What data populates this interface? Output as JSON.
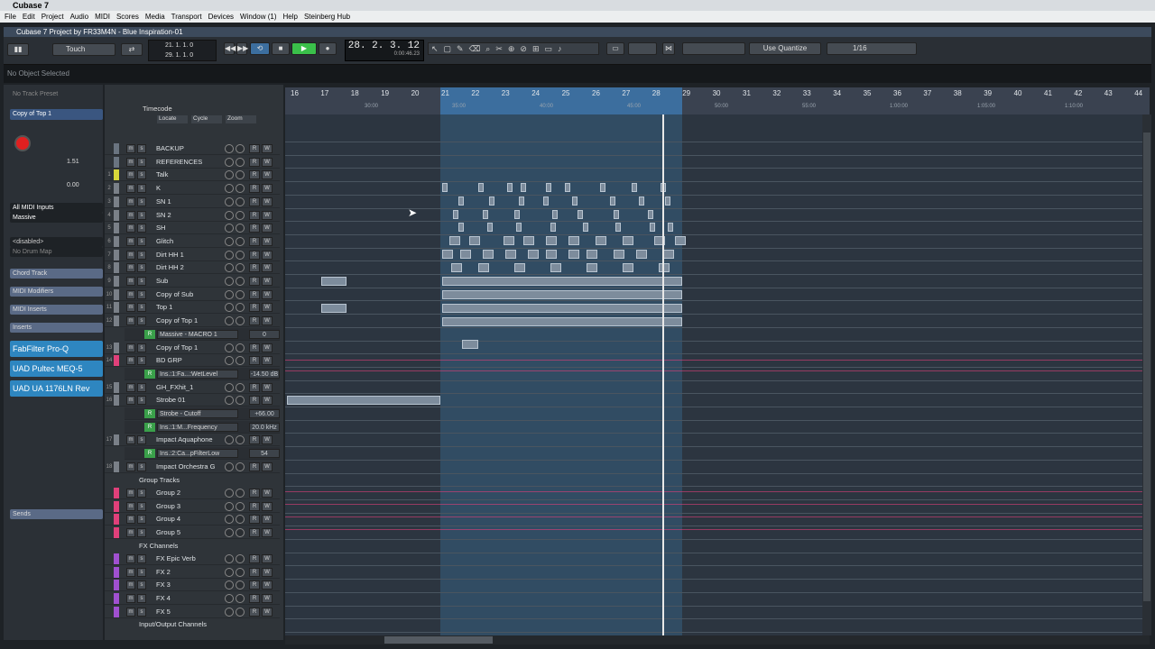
{
  "os": {
    "title": "Cubase 7",
    "menu": [
      "File",
      "Edit",
      "Project",
      "Audio",
      "MIDI",
      "Scores",
      "Media",
      "Transport",
      "Devices",
      "Window (1)",
      "Help",
      "Steinberg Hub"
    ]
  },
  "project": {
    "title": "Cubase 7 Project by FR33M4N - Blue Inspiration-01"
  },
  "toolbar": {
    "mode": "Touch",
    "left_locator": "21. 1. 1. 0",
    "right_locator": "29. 1. 1. 0",
    "position": "28. 2. 3. 12",
    "position_sub": "0:00:46.23",
    "quantize_label": "Use Quantize",
    "quantize_value": "1/16"
  },
  "infoline": {
    "text": "No Object Selected"
  },
  "inspector": {
    "preset": "No Track Preset",
    "track_name": "Copy of Top 1",
    "volume": "1.51",
    "pan": "0.00",
    "input": "All MIDI Inputs",
    "output": "Massive",
    "disabled": "<disabled>",
    "drum_map": "No Drum Map",
    "sections": [
      "Chord Track",
      "MIDI Modifiers",
      "MIDI Inserts",
      "Inserts"
    ],
    "plugins": [
      "FabFilter Pro-Q",
      "UAD Pultec MEQ-5",
      "UAD UA 1176LN Rev"
    ],
    "sends": "Sends"
  },
  "tracklist": {
    "timecode_label": "Timecode",
    "locate": "Locate",
    "cycle": "Cycle",
    "zoom": "Zoom",
    "tracks": [
      {
        "num": "",
        "name": "BACKUP",
        "color": "#6a7480"
      },
      {
        "num": "",
        "name": "REFERENCES",
        "color": "#6a7480"
      },
      {
        "num": "1",
        "name": "Talk",
        "color": "#d8d83a"
      },
      {
        "num": "2",
        "name": "K",
        "color": "#7a8088"
      },
      {
        "num": "3",
        "name": "SN 1",
        "color": "#7a8088"
      },
      {
        "num": "4",
        "name": "SN 2",
        "color": "#7a8088"
      },
      {
        "num": "5",
        "name": "SH",
        "color": "#7a8088"
      },
      {
        "num": "6",
        "name": "Glitch",
        "color": "#7a8088"
      },
      {
        "num": "7",
        "name": "Dirt HH 1",
        "color": "#7a8088"
      },
      {
        "num": "8",
        "name": "Dirt HH 2",
        "color": "#7a8088"
      },
      {
        "num": "9",
        "name": "Sub",
        "color": "#7a8088"
      },
      {
        "num": "10",
        "name": "Copy of Sub",
        "color": "#7a8088"
      },
      {
        "num": "11",
        "name": "Top 1",
        "color": "#7a8088"
      },
      {
        "num": "12",
        "name": "Copy of Top 1",
        "color": "#7a8088"
      }
    ],
    "auto1": {
      "label": "Massive - MACRO 1",
      "value": "0"
    },
    "tracks2": [
      {
        "num": "13",
        "name": "Copy of Top 1",
        "color": "#7a8088"
      },
      {
        "num": "14",
        "name": "BD GRP",
        "color": "#e0407a"
      }
    ],
    "auto2": {
      "label": "Ins.:1:Fa...:WetLevel",
      "value": "-14.50 dB"
    },
    "tracks3": [
      {
        "num": "15",
        "name": "GH_FXhit_1",
        "color": "#7a8088"
      },
      {
        "num": "16",
        "name": "Strobe 01",
        "color": "#7a8088"
      }
    ],
    "auto3": {
      "label": "Strobe - Cutoff",
      "value": "+66.00"
    },
    "auto4": {
      "label": "Ins.:1:M...Frequency",
      "value": "20.0 kHz"
    },
    "tracks4": [
      {
        "num": "17",
        "name": "Impact Aquaphone",
        "color": "#7a8088"
      }
    ],
    "auto5": {
      "label": "Ins.:2:Ca...pFilterLow",
      "value": "54"
    },
    "tracks5": [
      {
        "num": "18",
        "name": "Impact Orchestra G",
        "color": "#7a8088"
      }
    ],
    "group_folder": "Group Tracks",
    "groups": [
      "Group 2",
      "Group 3",
      "Group 4",
      "Group 5"
    ],
    "fx_folder": "FX Channels",
    "fx": [
      "FX Epic Verb",
      "FX 2",
      "FX 3",
      "FX 4",
      "FX 5"
    ],
    "io_folder": "Input/Output Channels"
  },
  "ruler": {
    "bars": [
      "16",
      "17",
      "18",
      "19",
      "20",
      "21",
      "22",
      "23",
      "24",
      "25",
      "26",
      "27",
      "28",
      "29",
      "30",
      "31",
      "32",
      "33",
      "34",
      "35",
      "36",
      "37",
      "38",
      "39",
      "40",
      "41",
      "42",
      "43",
      "44"
    ],
    "times": [
      "30:00",
      "35:00",
      "40:00",
      "45:00",
      "50:00",
      "55:00",
      "1:00:00",
      "1:05:00",
      "1:10:00"
    ]
  },
  "colors": {
    "accent": "#3a8ad0",
    "cycle": "#3c6e9e",
    "record": "#e02020",
    "play": "#3ac04a"
  }
}
